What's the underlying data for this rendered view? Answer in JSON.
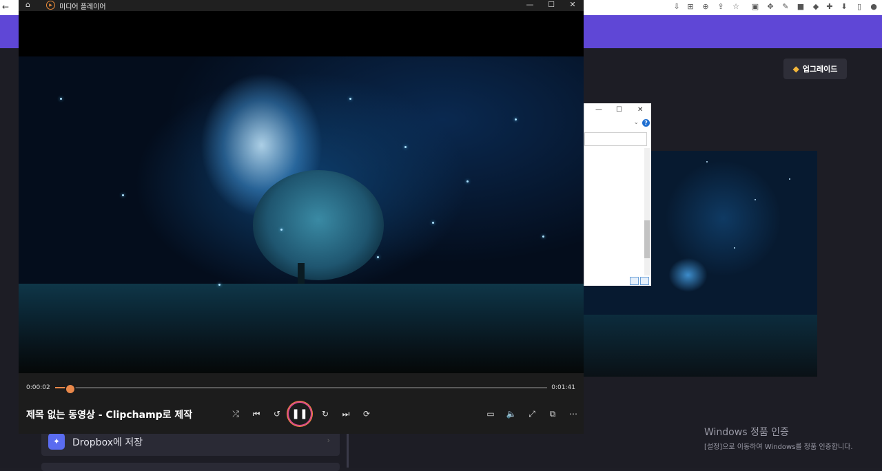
{
  "player": {
    "window_title": "미디어 플레이어",
    "current_time": "0:00:02",
    "total_time": "0:01:41",
    "progress": 0.03,
    "video_title": "제목 없는 동영상 - Clipchamp로 제작"
  },
  "app": {
    "upgrade_label": "업그레이드",
    "dropbox_label": "Dropbox에 저장"
  },
  "watermark": {
    "title": "Windows 정품 인증",
    "subtitle": "[설정]으로 이동하여 Windows를 정품 인증합니다."
  },
  "colors": {
    "accent": "#e9884a",
    "purple_band": "#5f47d6"
  },
  "icons": {
    "controls": [
      "shuffle-icon",
      "previous-icon",
      "rewind-10-icon",
      "pause-icon",
      "forward-30-icon",
      "next-icon",
      "repeat-icon"
    ],
    "right_controls": [
      "captions-icon",
      "volume-icon",
      "fullscreen-icon",
      "miniplayer-icon",
      "more-icon"
    ]
  }
}
